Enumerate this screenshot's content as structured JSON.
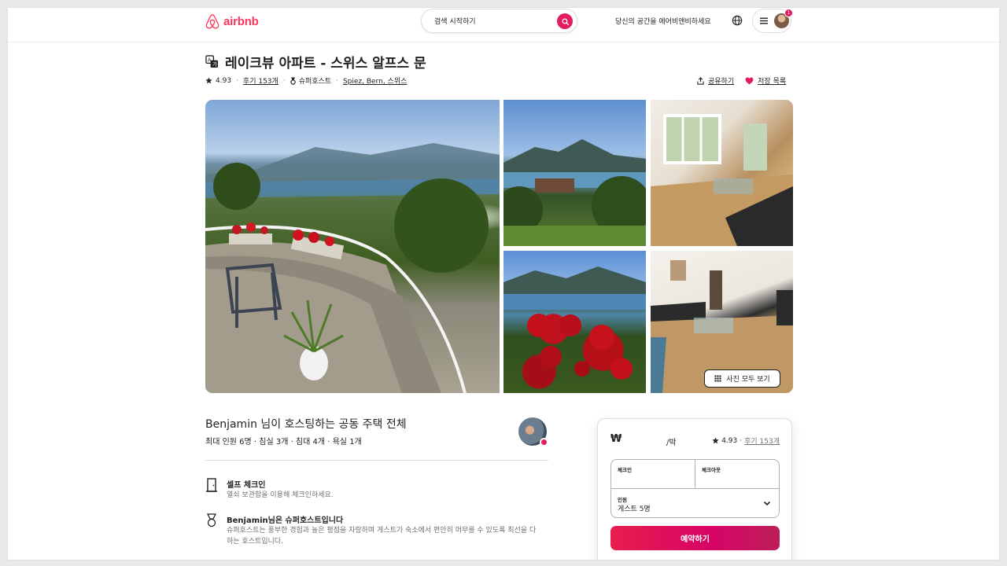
{
  "header": {
    "logo_text": "airbnb",
    "search_placeholder": "검색 시작하기",
    "host_link": "당신의 공간을 에어비앤비하세요",
    "notification_count": "1"
  },
  "listing": {
    "title": "레이크뷰 아파트 - 스위스 알프스 문",
    "rating": "4.93",
    "reviews": "후기 153개",
    "superhost": "슈퍼호스트",
    "location": "Spiez, Bern, 스위스",
    "share_label": "공유하기",
    "save_label": "저장 목록",
    "show_all_photos": "사진 모두 보기"
  },
  "host": {
    "title": "Benjamin 님이 호스팅하는 공동 주택 전체",
    "summary": "최대 인원 6명 · 침실 3개 · 침대 4개 · 욕실 1개"
  },
  "features": [
    {
      "icon": "door-icon",
      "title": "셀프 체크인",
      "desc": "열쇠 보관함을 이용해 체크인하세요."
    },
    {
      "icon": "medal-icon",
      "title": "Benjamin님은 슈퍼호스트입니다",
      "desc": "슈퍼호스트는 풍부한 경험과 높은 평점을 자랑하며 게스트가 숙소에서 편안히 머무를 수 있도록 최선을 다하는 호스트입니다."
    }
  ],
  "booking": {
    "currency": "₩",
    "per_night": "/박",
    "rating": "4.93",
    "reviews": "후기 153개",
    "checkin_label": "체크인",
    "checkout_label": "체크아웃",
    "guests_label": "인원",
    "guests_value": "게스트 5명",
    "reserve_label": "예약하기"
  },
  "colors": {
    "brand": "#ff385c",
    "reserve_gradient_start": "#e61e4d",
    "reserve_gradient_end": "#bd1e59"
  }
}
